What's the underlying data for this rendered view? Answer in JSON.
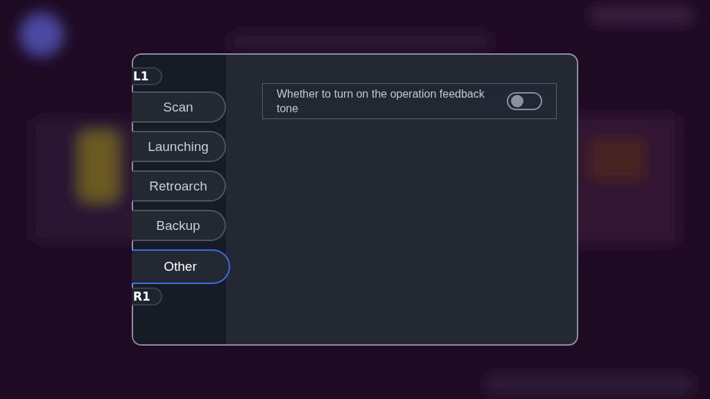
{
  "dialog": {
    "prev_hint": "L1",
    "tabs": [
      {
        "label": "Scan",
        "selected": false
      },
      {
        "label": "Launching",
        "selected": false
      },
      {
        "label": "Retroarch",
        "selected": false
      },
      {
        "label": "Backup",
        "selected": false
      },
      {
        "label": "Other",
        "selected": true
      }
    ],
    "next_hint": "R1",
    "settings": [
      {
        "label": "Whether to turn on the operation feedback tone",
        "on": false
      }
    ]
  }
}
